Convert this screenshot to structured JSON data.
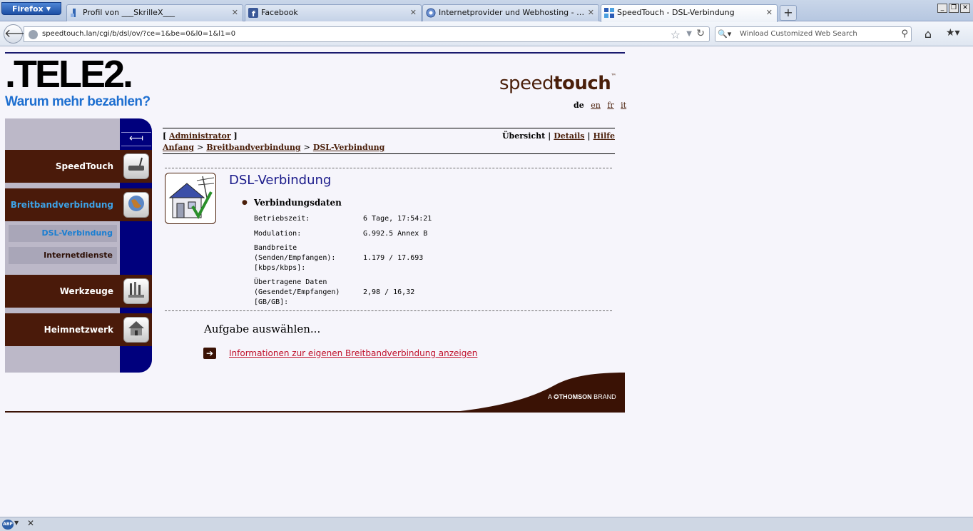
{
  "browser": {
    "menu_label": "Firefox",
    "tabs": [
      {
        "title": "Profil von ___SkrilleX___",
        "icon": "profile-favicon"
      },
      {
        "title": "Facebook",
        "icon": "facebook-favicon"
      },
      {
        "title": "Internetprovider und Webhosting - Neue...",
        "icon": "provider-favicon"
      },
      {
        "title": "SpeedTouch - DSL-Verbindung",
        "icon": "speedtouch-favicon"
      }
    ],
    "url": "speedtouch.lan/cgi/b/dsl/ov/?ce=1&be=0&l0=1&l1=0",
    "search_placeholder": "Winload Customized Web Search"
  },
  "header": {
    "tele2_word": ".TELE2.",
    "tele2_slogan": "Warum mehr bezahlen?",
    "speedtouch_light": "speed",
    "speedtouch_bold": "touch",
    "speedtouch_tm": "™",
    "languages": [
      {
        "code": "de",
        "current": true
      },
      {
        "code": "en",
        "current": false
      },
      {
        "code": "fr",
        "current": false
      },
      {
        "code": "it",
        "current": false
      }
    ]
  },
  "sidebar": {
    "items": [
      {
        "label": "SpeedTouch",
        "icon": "router-icon"
      },
      {
        "label": "Breitbandverbindung",
        "icon": "globe-icon",
        "active": true
      },
      {
        "label": "Werkzeuge",
        "icon": "tools-icon"
      },
      {
        "label": "Heimnetzwerk",
        "icon": "house-icon"
      }
    ],
    "subitems": [
      {
        "label": "DSL-Verbindung",
        "active": true
      },
      {
        "label": "Internetdienste",
        "active": false
      }
    ]
  },
  "toolbar": {
    "user_open": "[ ",
    "user": "Administrator",
    "user_close": " ]",
    "view_current": "Übersicht",
    "view_details": "Details",
    "view_help": "Hilfe",
    "sep": "|"
  },
  "breadcrumb": {
    "items": [
      "Anfang",
      "Breitbandverbindung",
      "DSL-Verbindung"
    ],
    "sep": ">"
  },
  "main": {
    "title": "DSL-Verbindung",
    "section": "Verbindungsdaten",
    "rows": [
      {
        "label": "Betriebszeit:",
        "value": "6 Tage, 17:54:21"
      },
      {
        "label": "Modulation:",
        "value": "G.992.5 Annex B"
      },
      {
        "label": "Bandbreite (Senden/Empfangen): [kbps/kbps]:",
        "value": "1.179 / 17.693"
      },
      {
        "label": "Übertragene Daten (Gesendet/Empfangen) [GB/GB]:",
        "value": "2,98 / 16,32"
      }
    ],
    "task_heading": "Aufgabe auswählen...",
    "task_link": "Informationen zur eigenen Breitbandverbindung anzeigen"
  },
  "footer": {
    "brand_prefix": "A",
    "brand_name": "THOMSON",
    "brand_suffix": "BRAND"
  },
  "statusbar": {
    "abp_label": "ABP"
  },
  "colors": {
    "brown": "#4a1a0a",
    "navy": "#00007d",
    "link_red": "#c0102a",
    "tele2_orange": "#f07c00",
    "tele2_blue": "#1e6fd0"
  }
}
